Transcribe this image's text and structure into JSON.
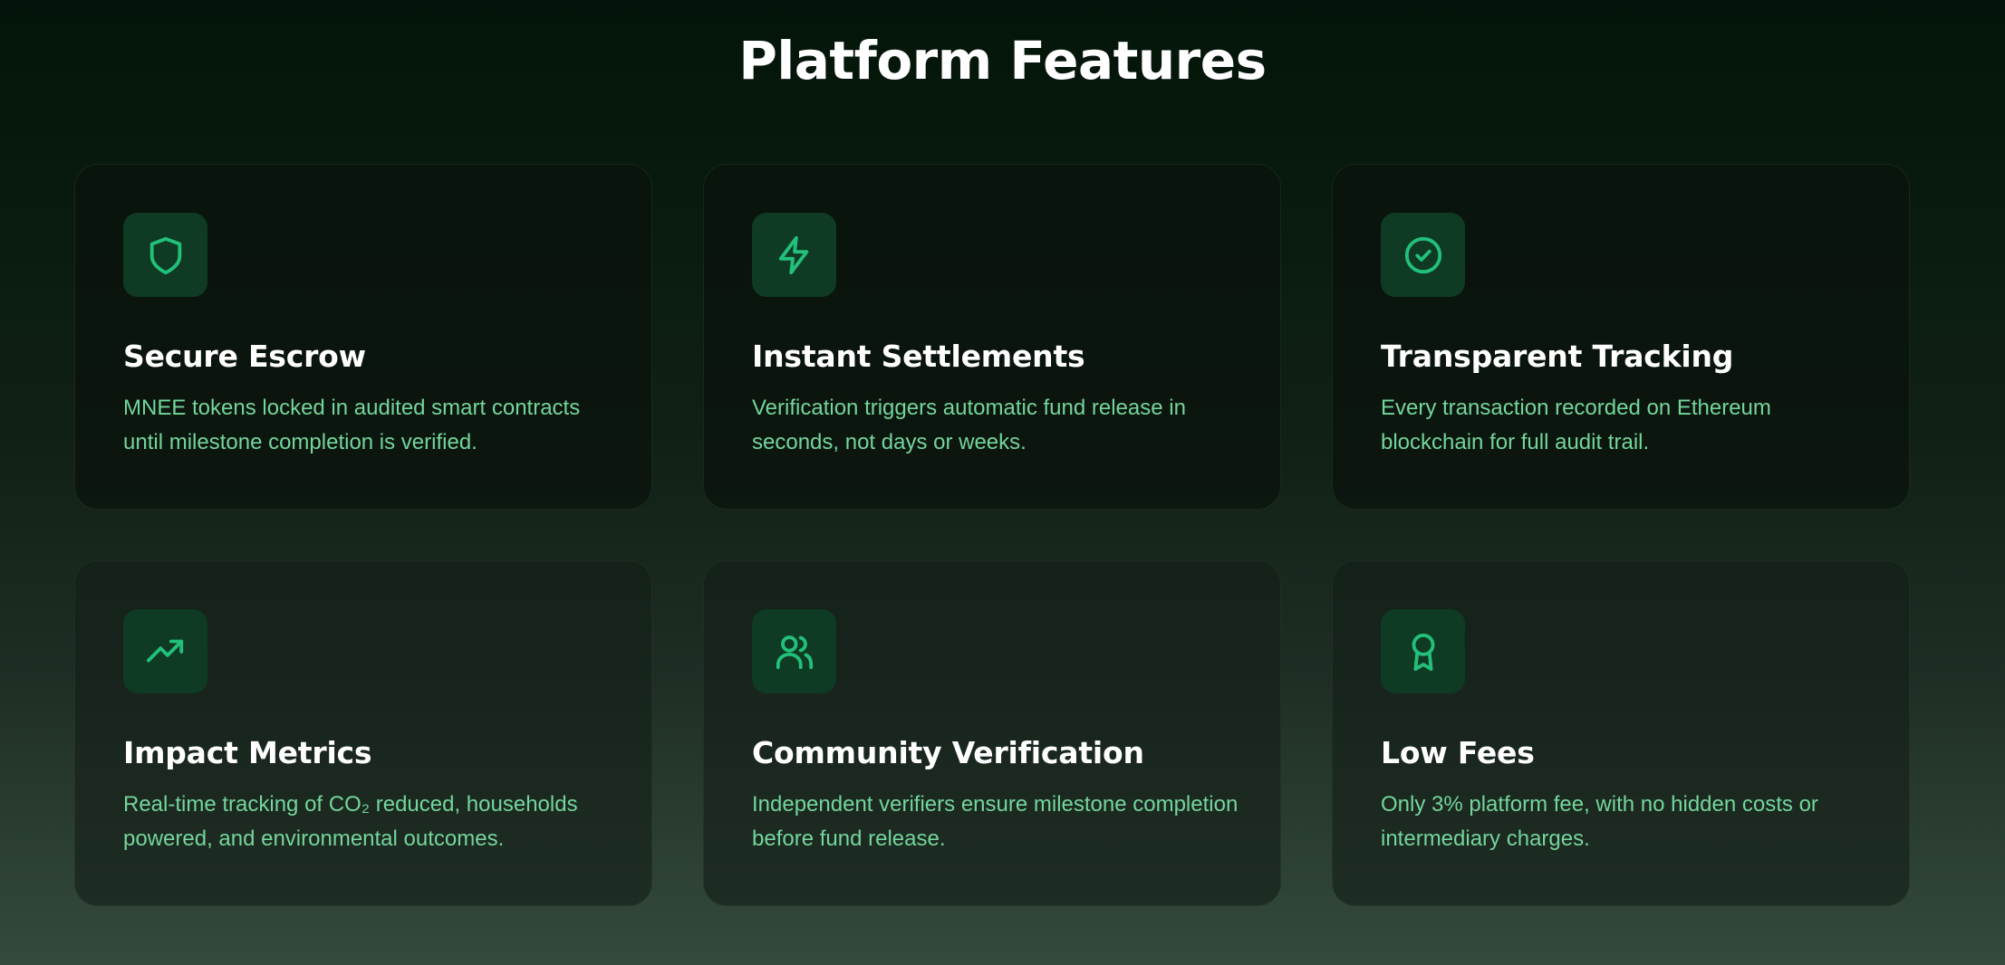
{
  "section": {
    "title": "Platform Features"
  },
  "features": [
    {
      "icon": "shield-icon",
      "title": "Secure Escrow",
      "description": "MNEE tokens locked in audited smart contracts until milestone completion is verified."
    },
    {
      "icon": "lightning-icon",
      "title": "Instant Settlements",
      "description": "Verification triggers automatic fund release in seconds, not days or weeks."
    },
    {
      "icon": "check-circle-icon",
      "title": "Transparent Tracking",
      "description": "Every transaction recorded on Ethereum blockchain for full audit trail."
    },
    {
      "icon": "trending-up-icon",
      "title": "Impact Metrics",
      "description": "Real-time tracking of CO₂ reduced, households powered, and environmental outcomes."
    },
    {
      "icon": "users-icon",
      "title": "Community Verification",
      "description": "Independent verifiers ensure milestone completion before fund release."
    },
    {
      "icon": "award-icon",
      "title": "Low Fees",
      "description": "Only 3% platform fee, with no hidden costs or intermediary charges."
    }
  ],
  "colors": {
    "accent": "#22c07a",
    "description_text": "#74d59b",
    "icon_background": "#0f3a24",
    "title_text": "#ffffff"
  }
}
